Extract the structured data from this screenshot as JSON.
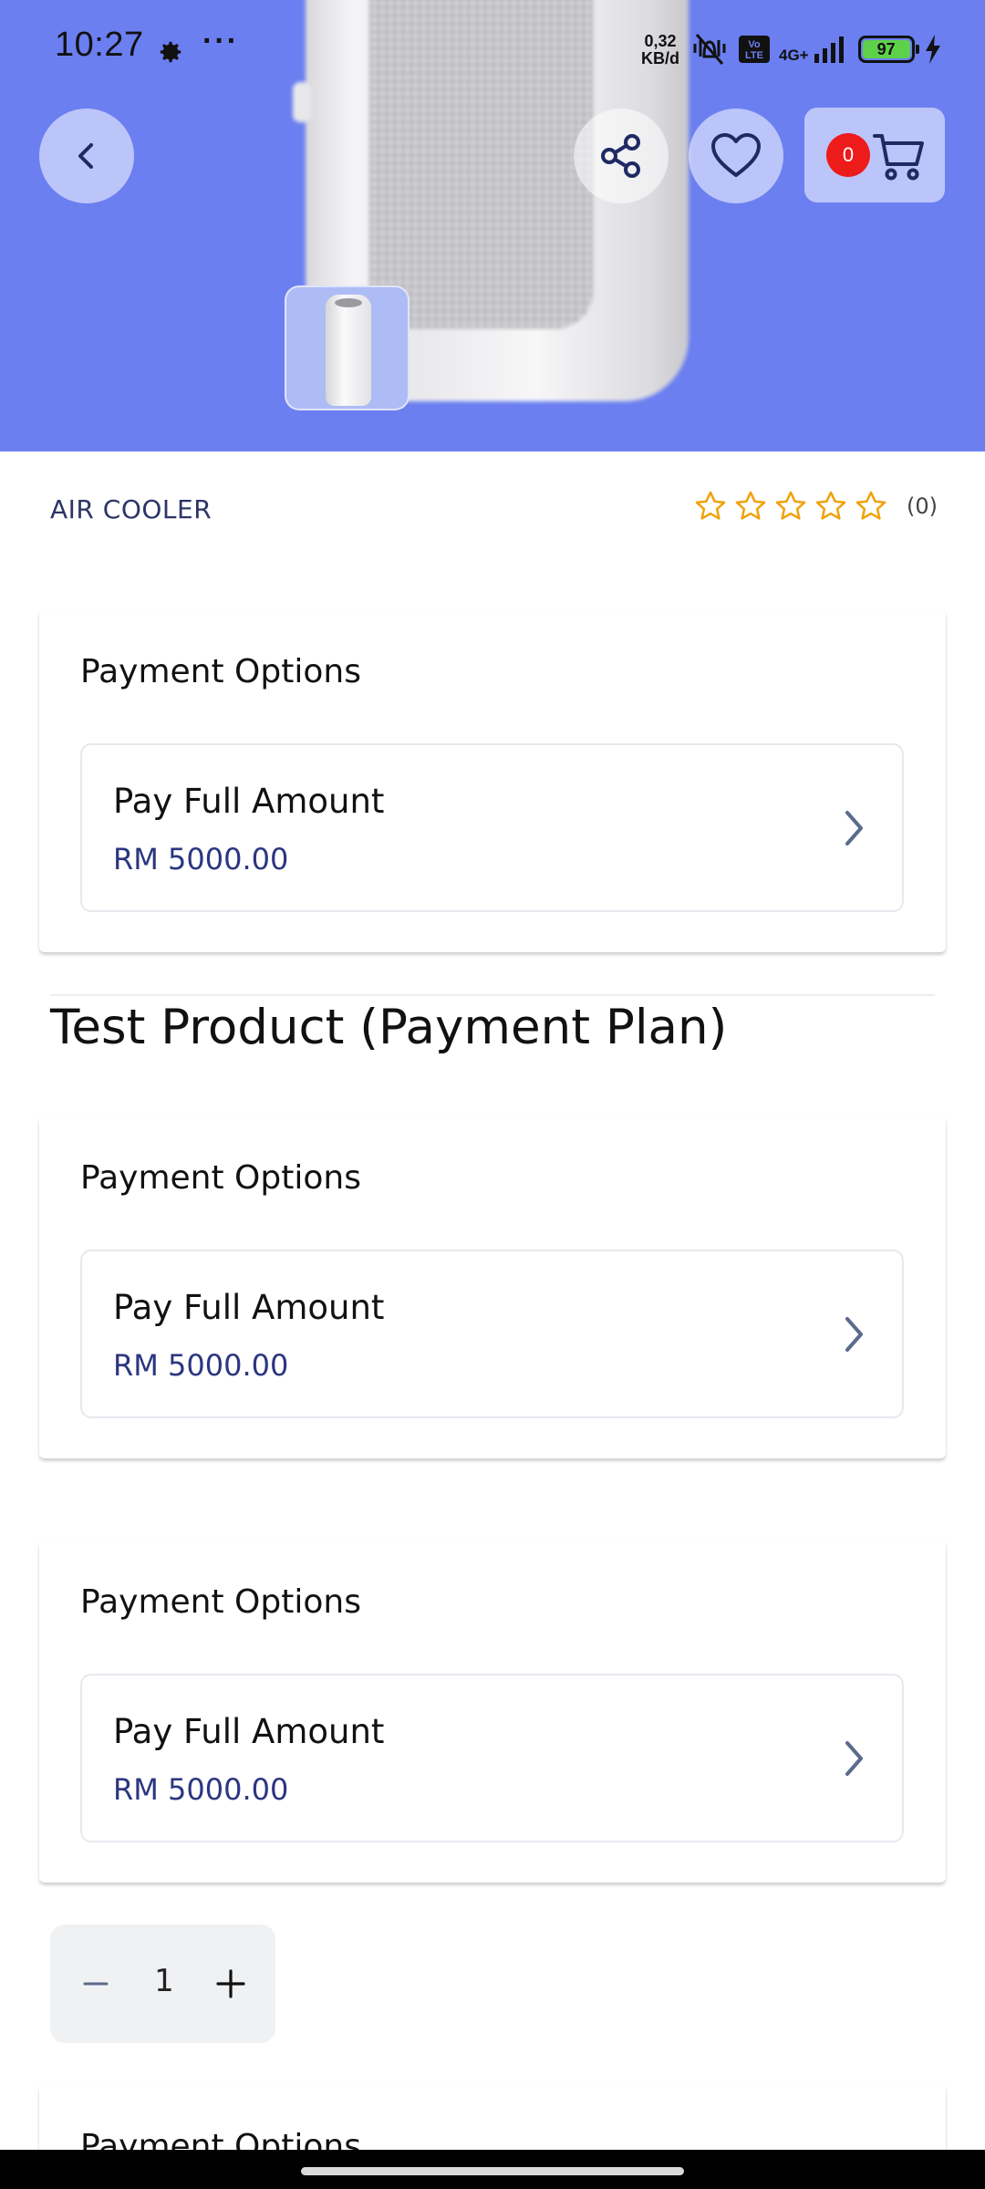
{
  "status_bar": {
    "time": "10:27",
    "dots": "···",
    "speed_value": "0,32",
    "speed_unit": "KB/d",
    "volte": "Vo LTE",
    "network": "4G+",
    "battery": "97"
  },
  "hero": {
    "cart_count": "0",
    "colors": {
      "background": "#6b7ff1",
      "badge": "#ee1b1b"
    }
  },
  "product": {
    "category": "AIR COOLER",
    "rating_count": "(0)",
    "rating_value": 0,
    "rating_max": 5,
    "title": "Test Product (Payment Plan)"
  },
  "payment_cards": [
    {
      "title": "Payment Options",
      "option_name": "Pay Full Amount",
      "option_price": "RM 5000.00"
    },
    {
      "title": "Payment Options",
      "option_name": "Pay Full Amount",
      "option_price": "RM 5000.00"
    },
    {
      "title": "Payment Options",
      "option_name": "Pay Full Amount",
      "option_price": "RM 5000.00"
    },
    {
      "title": "Payment Options"
    }
  ],
  "quantity": {
    "value": "1",
    "minus": "−",
    "plus": "+"
  }
}
